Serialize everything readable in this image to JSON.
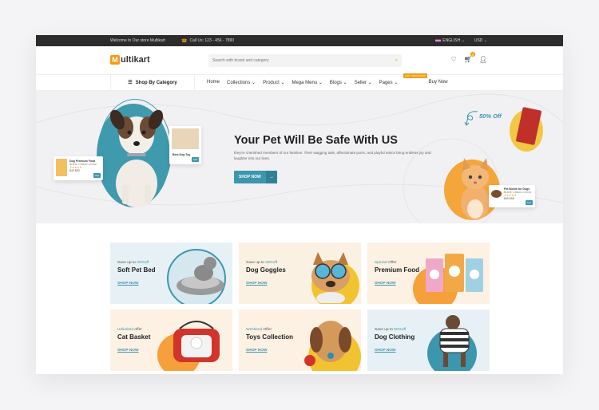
{
  "topbar": {
    "welcome": "Welcome to Our store Multikart",
    "phone": "Call Us: 123 - 456 - 7890",
    "language": "ENGLISH",
    "currency": "USD"
  },
  "header": {
    "logo_letter": "M",
    "logo_text": "ultikart",
    "search_placeholder": "Search with brand and category",
    "cart_count": "0"
  },
  "nav": {
    "shop_by_category": "Shop By Category",
    "links": [
      "Home",
      "Collections",
      "Product",
      "Mega Menu",
      "Blogs",
      "Seller",
      "Pages",
      "Buy Now"
    ],
    "hot_badge": "HOT ITEM/OFFER"
  },
  "hero": {
    "title": "Your Pet Will Be Safe With US",
    "text": "they're cherished members of our families. Their wagging tails, affectionate purrs, and playful antics bring endless joy and laughter into our lives.",
    "button": "SHOP NOW",
    "offer": "50% Off",
    "card1": {
      "name": "Dog Premium Food",
      "sub": "Brand: Classic Cereal",
      "stars": "★★★★★",
      "price": "$42 $50",
      "btn": "Add"
    },
    "card2": {
      "name": "Best Dog Toy",
      "btn": "Add"
    },
    "card3": {
      "name": "Pet Bowls for Dogs",
      "sub": "Brand: Classic Cereal",
      "stars": "★★★★★",
      "price": "$45 $58",
      "btn": "Add"
    }
  },
  "categories": [
    {
      "pre": "Save up to ",
      "hl": "20%off",
      "post": "",
      "title": "Soft Pet Bed",
      "shop": "SHOP NOW"
    },
    {
      "pre": "Save up to ",
      "hl": "40%off",
      "post": "",
      "title": "Dog Goggles",
      "shop": "SHOP NOW"
    },
    {
      "pre": "",
      "hl": "Special",
      "post": " Offer",
      "title": "Premium Food",
      "shop": "SHOP NOW"
    },
    {
      "pre": "",
      "hl": "Unlimited",
      "post": " offer",
      "title": "Cat Basket",
      "shop": "SHOP NOW"
    },
    {
      "pre": "",
      "hl": "Weekend",
      "post": " Offer",
      "title": "Toys Collection",
      "shop": "SHOP NOW"
    },
    {
      "pre": "Save up to ",
      "hl": "60%off",
      "post": "",
      "title": "Dog Clothing",
      "shop": "SHOP NOW"
    }
  ],
  "colors": {
    "accent": "#3c96ad",
    "brand": "#f39c12",
    "topbar": "#2c2c2c"
  }
}
